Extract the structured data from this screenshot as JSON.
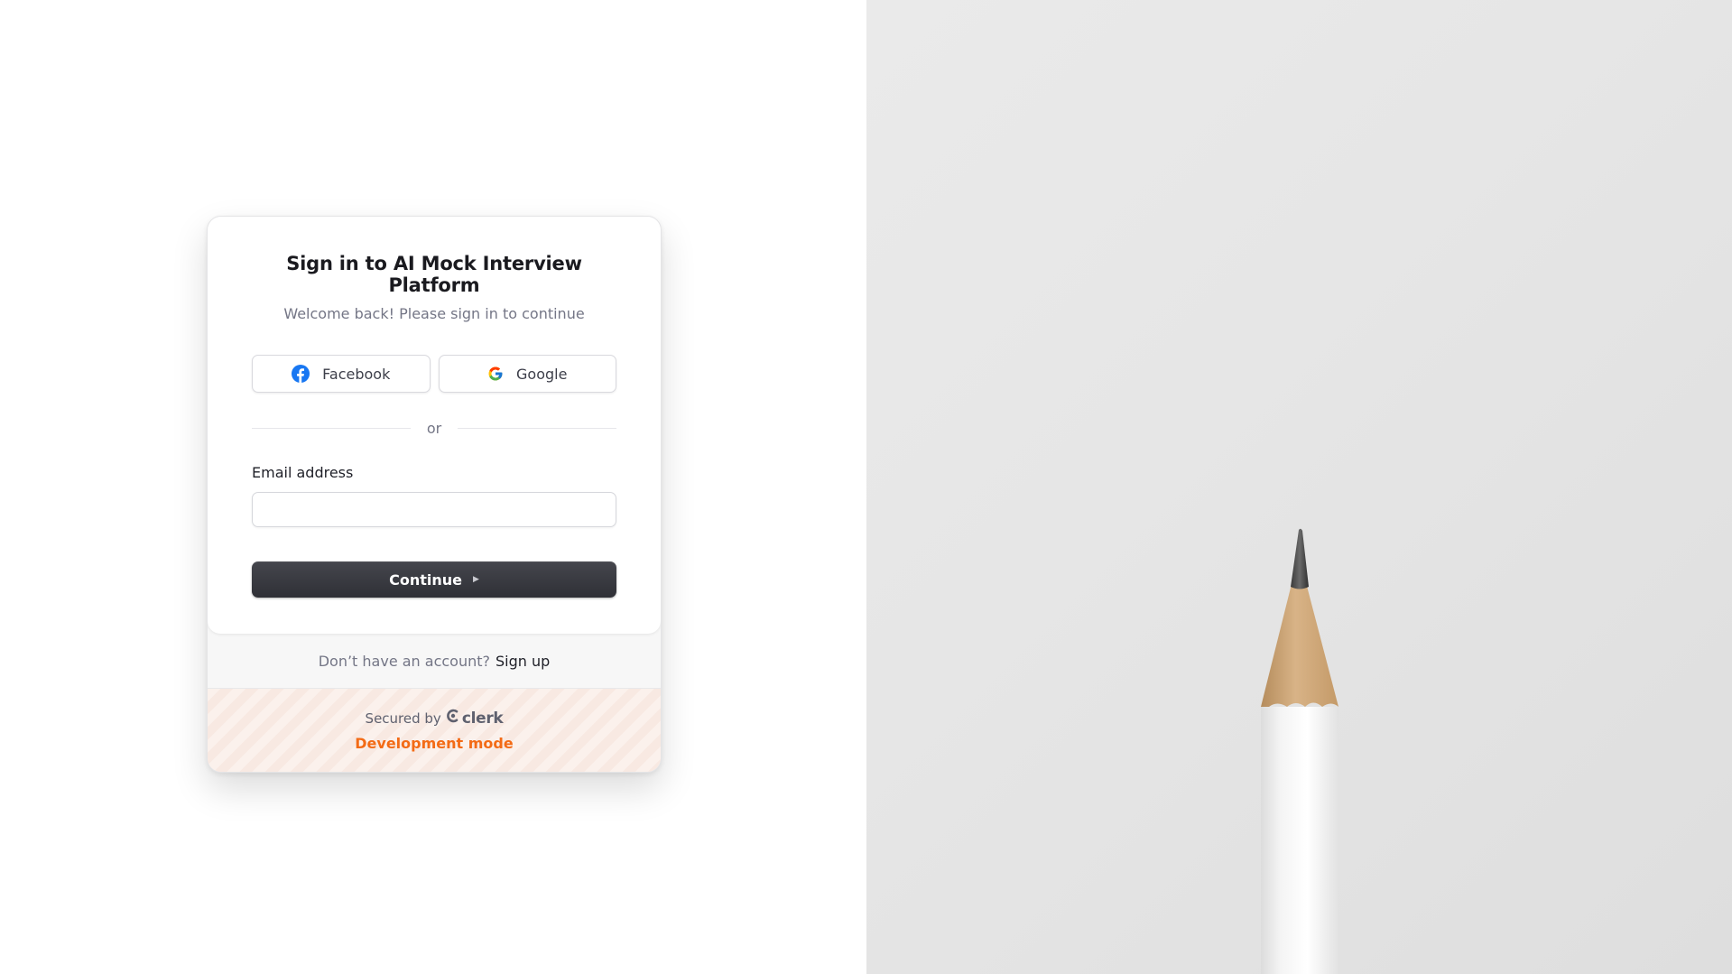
{
  "signin": {
    "title": "Sign in to AI Mock Interview Platform",
    "subtitle": "Welcome back! Please sign in to continue",
    "social": [
      {
        "label": "Facebook",
        "icon": "facebook-icon"
      },
      {
        "label": "Google",
        "icon": "google-icon"
      }
    ],
    "divider_text": "or",
    "email": {
      "label": "Email address",
      "value": "",
      "placeholder": ""
    },
    "continue_label": "Continue",
    "continue_icon": "caret-right-icon"
  },
  "footer": {
    "signup_prompt": "Don’t have an account?",
    "signup_link": "Sign up",
    "secured_by": "Secured by",
    "brand": "clerk",
    "dev_mode": "Development mode"
  },
  "colors": {
    "primary_button": "#2f3036",
    "dev_mode": "#f36b16",
    "facebook": "#1877f2",
    "background_right": "#e6e6e6"
  },
  "hero_image": {
    "icon": "pencil-image"
  }
}
